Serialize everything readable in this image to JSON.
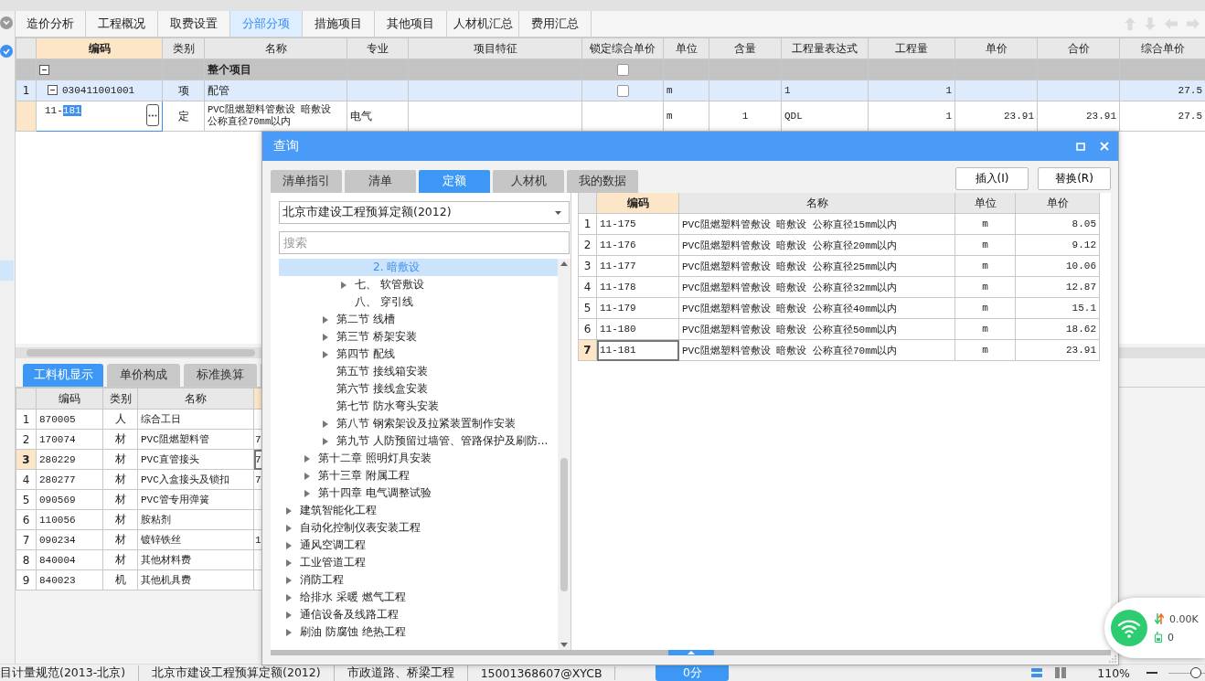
{
  "main_tabs": [
    {
      "label": "造价分析",
      "selected": false
    },
    {
      "label": "工程概况",
      "selected": false
    },
    {
      "label": "取费设置",
      "selected": false
    },
    {
      "label": "分部分项",
      "selected": true
    },
    {
      "label": "措施项目",
      "selected": false
    },
    {
      "label": "其他项目",
      "selected": false
    },
    {
      "label": "人材机汇总",
      "selected": false
    },
    {
      "label": "费用汇总",
      "selected": false
    }
  ],
  "item_table": {
    "columns": [
      "编码",
      "类别",
      "名称",
      "专业",
      "项目特征",
      "锁定综合单价",
      "单位",
      "含量",
      "工程量表达式",
      "工程量",
      "单价",
      "合价",
      "综合单价"
    ],
    "rows": [
      {
        "kind": "group",
        "expanded": true,
        "name": "整个项目",
        "locked": false
      },
      {
        "kind": "item",
        "number": "1",
        "expanded": true,
        "code": "030411001001",
        "type": "项",
        "name": "配管",
        "locked": false,
        "unit": "m",
        "expression": "1",
        "quantity": "1",
        "composite_price": "27.5"
      },
      {
        "kind": "quota",
        "code_prefix": "11-",
        "code_selected": "181",
        "type": "定",
        "name": "PVC阻燃塑料管敷设 暗敷设公称直径70mm以内",
        "specialty": "电气",
        "unit": "m",
        "content": "1",
        "expression": "QDL",
        "quantity": "1",
        "unit_price": "23.91",
        "total": "23.91",
        "composite_price": "27.5"
      }
    ]
  },
  "bottom_tabs": [
    {
      "label": "工料机显示",
      "selected": true
    },
    {
      "label": "单价构成",
      "selected": false
    },
    {
      "label": "标准换算",
      "selected": false
    }
  ],
  "resource_table": {
    "columns": [
      "编码",
      "类别",
      "名称"
    ],
    "rows": [
      {
        "number": "1",
        "code": "870005",
        "type": "人",
        "name": "综合工日",
        "selected": false
      },
      {
        "number": "2",
        "code": "170074",
        "type": "材",
        "name": "PVC阻燃塑料管",
        "column_5": "7",
        "selected": false
      },
      {
        "number": "3",
        "code": "280229",
        "type": "材",
        "name": "PVC直管接头",
        "column_5": "7",
        "selected": true
      },
      {
        "number": "4",
        "code": "280277",
        "type": "材",
        "name": "PVC入盒接头及锁扣",
        "column_5": "7",
        "selected": false
      },
      {
        "number": "5",
        "code": "090569",
        "type": "材",
        "name": "PVC管专用弹簧",
        "selected": false
      },
      {
        "number": "6",
        "code": "110056",
        "type": "材",
        "name": "胺粘剂",
        "selected": false
      },
      {
        "number": "7",
        "code": "090234",
        "type": "材",
        "name": "镀锌铁丝",
        "column_5": "1",
        "selected": false
      },
      {
        "number": "8",
        "code": "840004",
        "type": "材",
        "name": "其他材料费",
        "selected": false
      },
      {
        "number": "9",
        "code": "840023",
        "type": "机",
        "name": "其他机具费",
        "selected": false
      }
    ]
  },
  "dialog": {
    "title": "查询",
    "tabs": [
      {
        "label": "清单指引",
        "selected": false
      },
      {
        "label": "清单",
        "selected": false
      },
      {
        "label": "定额",
        "selected": true
      },
      {
        "label": "人材机",
        "selected": false
      },
      {
        "label": "我的数据",
        "selected": false
      }
    ],
    "buttons": [
      "插入(I)",
      "替换(R)"
    ],
    "library": "北京市建设工程预算定额(2012)",
    "search": {
      "placeholder": "搜索"
    },
    "tree": [
      {
        "children": [
          {
            "children": [
              {
                "children": [
                  {
                    "children": [
                      {
                        "label": "2. 暗敷设",
                        "expandable": false,
                        "selected": true
                      }
                    ]
                  },
                  {
                    "label": "七、 软管敷设",
                    "expandable": true,
                    "selected": false
                  },
                  {
                    "label": "八、 穿引线",
                    "expandable": false,
                    "selected": false
                  }
                ]
              },
              {
                "label": "第二节 线槽",
                "expandable": true,
                "selected": false
              },
              {
                "label": "第三节 桥架安装",
                "expandable": true,
                "selected": false
              },
              {
                "label": "第四节 配线",
                "expandable": true,
                "selected": false
              },
              {
                "label": "第五节 接线箱安装",
                "expandable": false,
                "selected": false
              },
              {
                "label": "第六节 接线盒安装",
                "expandable": false,
                "selected": false
              },
              {
                "label": "第七节 防水弯头安装",
                "expandable": false,
                "selected": false
              },
              {
                "label": "第八节 钢索架设及拉紧装置制作安装",
                "expandable": true,
                "selected": false
              },
              {
                "label": "第九节 人防预留过墙管、管路保护及刷防...",
                "expandable": true,
                "selected": false
              }
            ]
          },
          {
            "label": "第十二章 照明灯具安装",
            "expandable": true,
            "selected": false
          },
          {
            "label": "第十三章 附属工程",
            "expandable": true,
            "selected": false
          },
          {
            "label": "第十四章 电气调整试验",
            "expandable": true,
            "selected": false
          }
        ]
      },
      {
        "label": "建筑智能化工程",
        "expandable": true,
        "selected": false
      },
      {
        "label": "自动化控制仪表安装工程",
        "expandable": true,
        "selected": false
      },
      {
        "label": "通风空调工程",
        "expandable": true,
        "selected": false
      },
      {
        "label": "工业管道工程",
        "expandable": true,
        "selected": false
      },
      {
        "label": "消防工程",
        "expandable": true,
        "selected": false
      },
      {
        "label": "给排水 采暖 燃气工程",
        "expandable": true,
        "selected": false
      },
      {
        "label": "通信设备及线路工程",
        "expandable": true,
        "selected": false
      },
      {
        "label": "刷油 防腐蚀 绝热工程",
        "expandable": true,
        "selected": false
      }
    ],
    "results": {
      "columns": [
        "编码",
        "名称",
        "单位",
        "单价"
      ],
      "rows": [
        {
          "number": "1",
          "code": "11-175",
          "name": "PVC阻燃塑料管敷设 暗敷设 公称直径15mm以内",
          "unit": "m",
          "price": "8.05",
          "selected": false
        },
        {
          "number": "2",
          "code": "11-176",
          "name": "PVC阻燃塑料管敷设 暗敷设 公称直径20mm以内",
          "unit": "m",
          "price": "9.12",
          "selected": false
        },
        {
          "number": "3",
          "code": "11-177",
          "name": "PVC阻燃塑料管敷设 暗敷设 公称直径25mm以内",
          "unit": "m",
          "price": "10.06",
          "selected": false
        },
        {
          "number": "4",
          "code": "11-178",
          "name": "PVC阻燃塑料管敷设 暗敷设 公称直径32mm以内",
          "unit": "m",
          "price": "12.87",
          "selected": false
        },
        {
          "number": "5",
          "code": "11-179",
          "name": "PVC阻燃塑料管敷设 暗敷设 公称直径40mm以内",
          "unit": "m",
          "price": "15.1",
          "selected": false
        },
        {
          "number": "6",
          "code": "11-180",
          "name": "PVC阻燃塑料管敷设 暗敷设 公称直径50mm以内",
          "unit": "m",
          "price": "18.62",
          "selected": false
        },
        {
          "number": "7",
          "code": "11-181",
          "name": "PVC阻燃塑料管敷设 暗敷设 公称直径70mm以内",
          "unit": "m",
          "price": "23.91",
          "selected": true
        }
      ]
    }
  },
  "network_widget": {
    "speed": "0.00K",
    "count": "0"
  },
  "status_bar": {
    "items": [
      "目计量规范(2013-北京)",
      "北京市建设工程预算定额(2012)",
      "市政道路、桥梁工程",
      "15001368607@XYCB"
    ],
    "score_button": "0分",
    "zoom": "110%",
    "zoom_slider": {
      "level": 0.5
    }
  }
}
